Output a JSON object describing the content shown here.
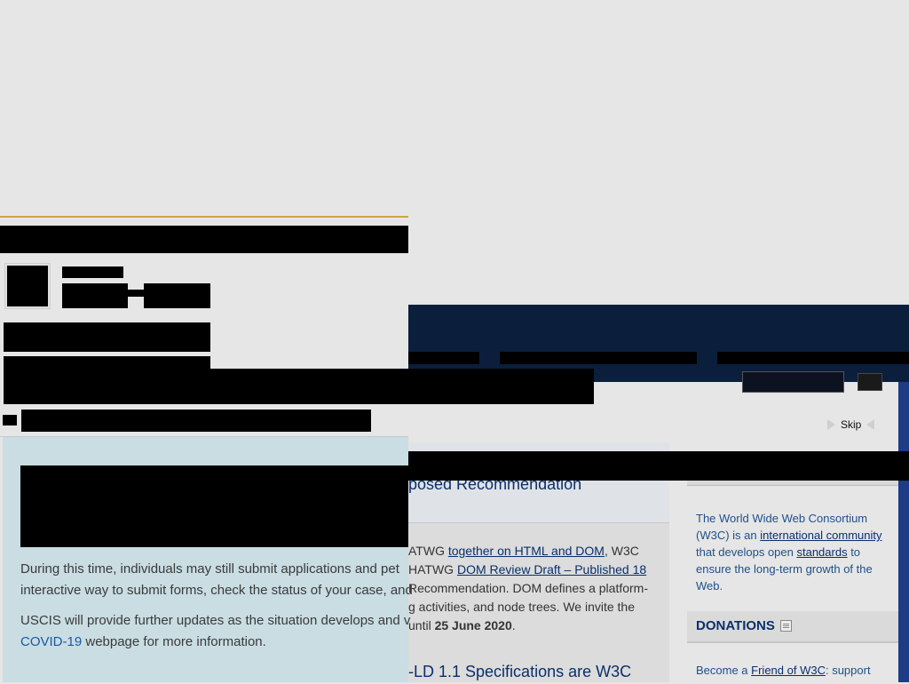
{
  "w3c": {
    "skip_label": "Skip",
    "news": {
      "headline_1": "posed Recommendation",
      "body_prefix_1": "ATWG ",
      "link_html_dom": "together on HTML and DOM",
      "body_mid_1": ", W3C",
      "body_prefix_2": "HATWG ",
      "link_dom_review": "DOM Review Draft – Published 18",
      "body_line_3": "Recommendation. DOM defines a platform-",
      "body_line_4": "g activities, and node trees. We invite the",
      "body_prefix_5": "until ",
      "body_date": "25 June 2020",
      "body_suffix_5": ".",
      "headline_2": "-LD 1.1 Specifications are W3C"
    },
    "sidebar": {
      "about_prefix": "The World Wide Web Consortium (W3C) is an ",
      "about_link_community": "international community",
      "about_mid": " that develops open ",
      "about_link_standards": "standards",
      "about_suffix": " to ensure the long-term growth of the Web.",
      "donations_title": "DONATIONS",
      "donations_prefix": "Become a ",
      "donations_link": "Friend of W3C",
      "donations_suffix": ": support"
    },
    "colors": {
      "header_bg": "#0b1f3d",
      "link": "#0a2f6b"
    }
  },
  "uscis": {
    "alert": {
      "p1": "During this time, individuals may still submit applications and pet",
      "p1b": "interactive way to submit forms, check the status of your case, and",
      "p2_prefix": "USCIS will provide further updates as the situation develops and v",
      "p2_link": "COVID-19",
      "p2_suffix": " webpage for more information."
    },
    "colors": {
      "alert_bg": "#c9dde3",
      "top_border": "#c9a64a"
    }
  }
}
